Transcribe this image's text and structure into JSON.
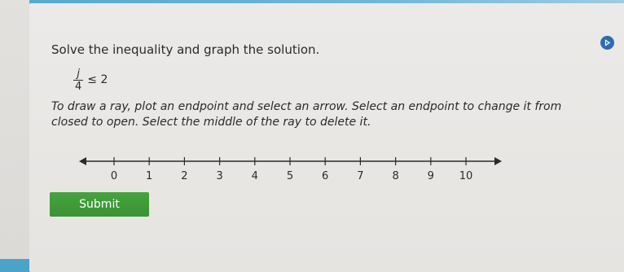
{
  "problem": {
    "prompt": "Solve the inequality and graph the solution.",
    "inequality": {
      "numerator": "j",
      "denominator": "4",
      "relation": "≤ 2"
    },
    "instructions": "To draw a ray, plot an endpoint and select an arrow. Select an endpoint to change it from closed to open. Select the middle of the ray to delete it."
  },
  "number_line": {
    "min": 0,
    "max": 10,
    "tick_labels": [
      "0",
      "1",
      "2",
      "3",
      "4",
      "5",
      "6",
      "7",
      "8",
      "9",
      "10"
    ]
  },
  "submit_label": "Submit",
  "icons": {
    "corner": "play-circle-icon"
  },
  "colors": {
    "accent_button": "#46a33f",
    "corner_icon": "#2f6db0"
  }
}
